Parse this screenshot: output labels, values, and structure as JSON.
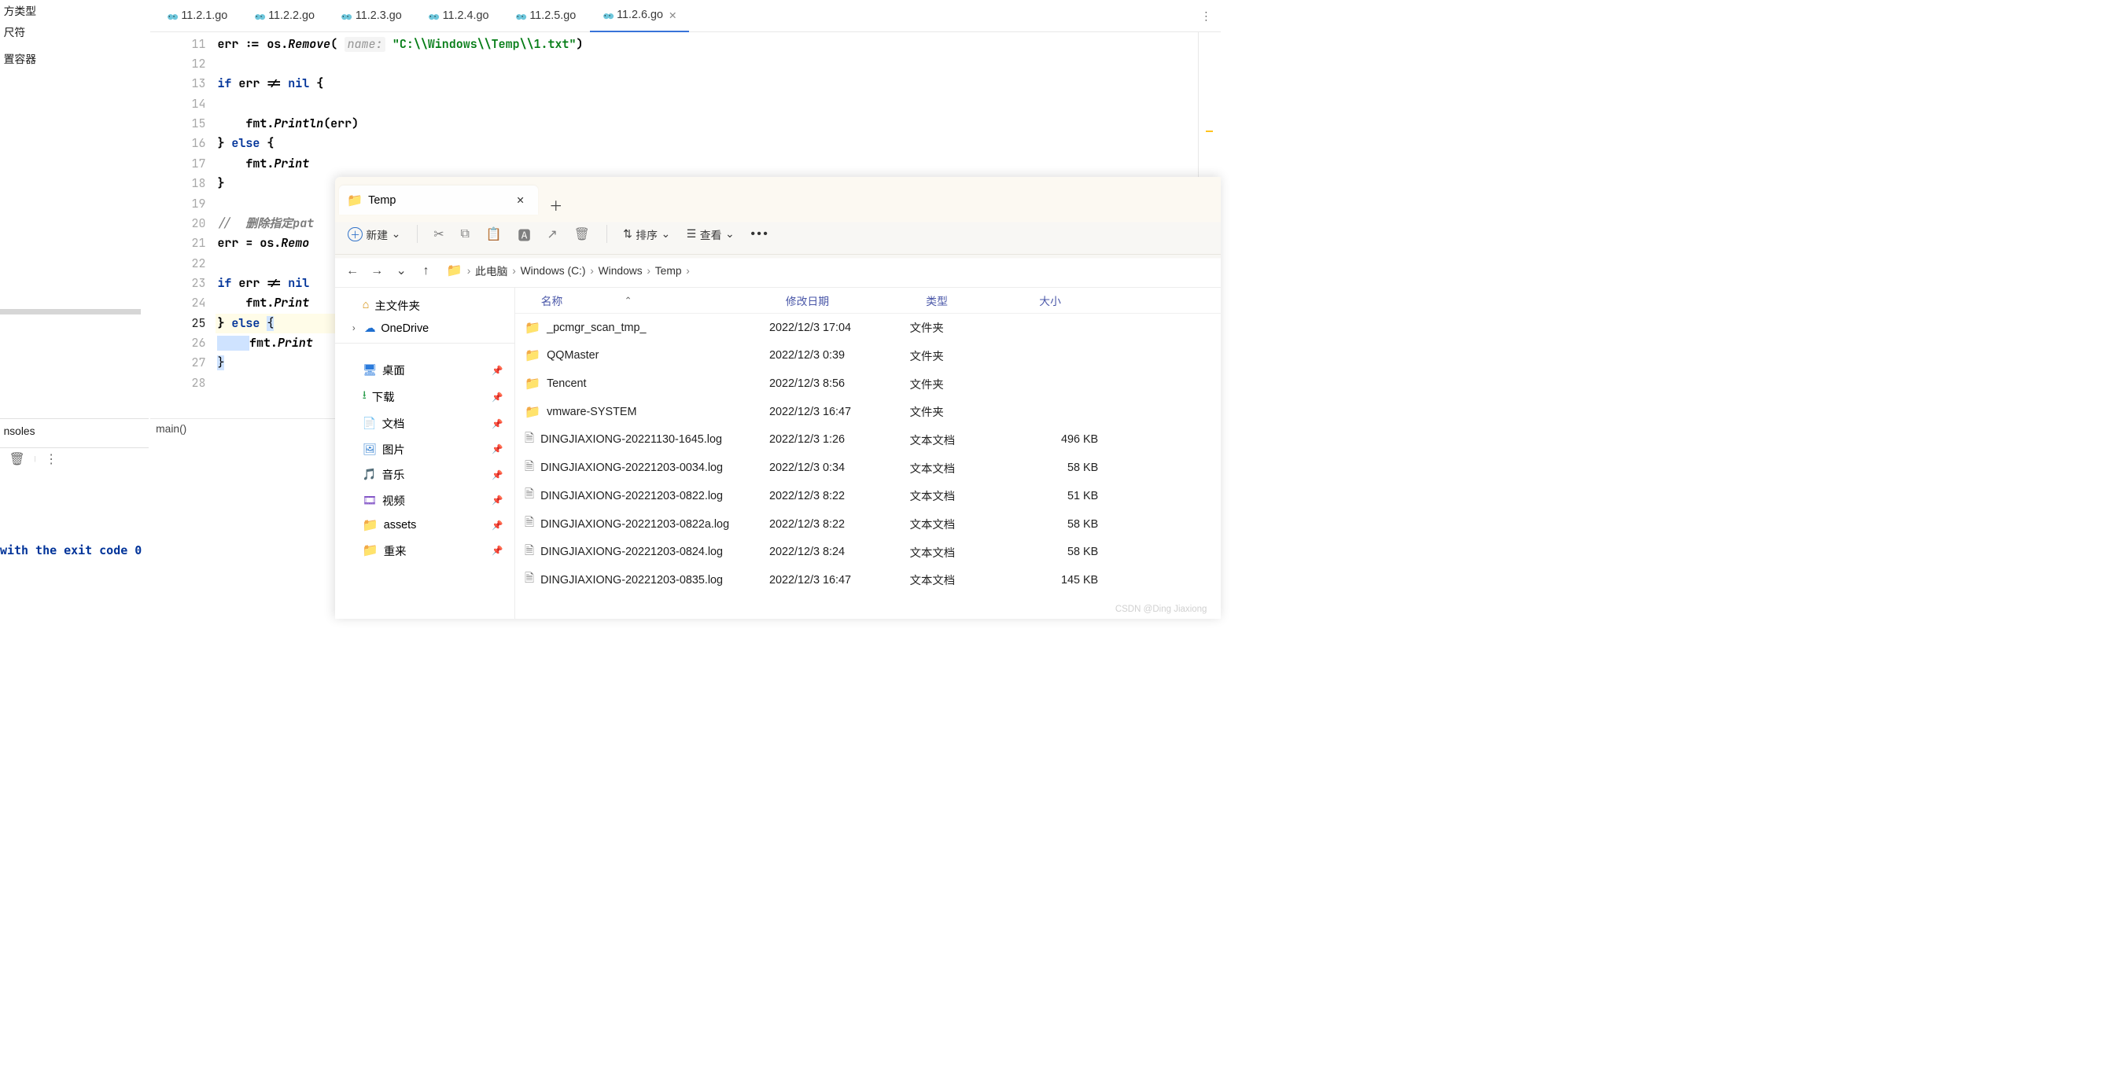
{
  "ide": {
    "left_panel": {
      "items": [
        {
          "label": "方类型"
        },
        {
          "label": "尺符"
        },
        {
          "label": ""
        },
        {
          "label": "置容器"
        }
      ],
      "selected_index": null,
      "footer_label": "nsoles"
    },
    "tabs": [
      {
        "label": "11.2.1.go"
      },
      {
        "label": "11.2.2.go"
      },
      {
        "label": "11.2.3.go"
      },
      {
        "label": "11.2.4.go"
      },
      {
        "label": "11.2.5.go"
      },
      {
        "label": "11.2.6.go",
        "active": true
      }
    ],
    "gutter_start": 11,
    "code_lines": [
      {
        "html": "<span class='bold'>err := os.</span><span class='bold fn-ital'>Remove</span><span class='bold'>(</span> <span class='hint'>name:</span> <span class='str'>\"C:\\\\Windows\\\\Temp\\\\1.txt\"</span><span class='bold'>)</span>"
      },
      {
        "html": ""
      },
      {
        "html": "<span class='k'>if</span><span class='bold'> err != </span><span class='k'>nil</span><span class='bold'> {</span>"
      },
      {
        "html": ""
      },
      {
        "html": "    <span class='bold'>fmt.</span><span class='bold fn-ital'>Println</span><span class='bold'>(err)</span>"
      },
      {
        "html": "<span class='bold'>} </span><span class='k'>else</span><span class='bold'> {</span>"
      },
      {
        "html": "    <span class='bold'>fmt.</span><span class='bold fn-ital'>Print</span>"
      },
      {
        "html": "<span class='bold'>}</span>"
      },
      {
        "html": ""
      },
      {
        "html": "<span class='cmt'>//  </span><span class='cmt-bold'>删除指定</span><span class='cmt-bold'>pat</span>"
      },
      {
        "html": "<span class='bold'>err = os.</span><span class='bold fn-ital'>Remo</span>"
      },
      {
        "html": ""
      },
      {
        "html": "<span class='k'>if</span><span class='bold'> err != </span><span class='k'>nil</span>"
      },
      {
        "html": "    <span class='bold'>fmt.</span><span class='bold fn-ital'>Print</span>"
      },
      {
        "html": "<span class='bold'>} </span><span class='k'>else</span><span class='bold'> </span><span class='sel'>{</span>",
        "current": true
      },
      {
        "html": "<span class='sel' style='padding-left:8px'>    </span><span class='bold'>fmt.</span><span class='bold fn-ital'>Print</span>"
      },
      {
        "html": "<span class='sel paren-hl'>}</span>"
      },
      {
        "html": ""
      }
    ],
    "breadcrumb": "main()",
    "run_output": "with the exit code 0"
  },
  "explorer": {
    "tab_title": "Temp",
    "toolbar": {
      "new_label": "新建",
      "sort_label": "排序",
      "view_label": "查看"
    },
    "breadcrumb": [
      "此电脑",
      "Windows (C:)",
      "Windows",
      "Temp"
    ],
    "sidebar": {
      "home_label": "主文件夹",
      "onedrive_label": "OneDrive",
      "quick_items": [
        {
          "icon": "desktop",
          "label": "桌面",
          "pinned": true
        },
        {
          "icon": "download",
          "label": "下载",
          "pinned": true
        },
        {
          "icon": "doc",
          "label": "文档",
          "pinned": true
        },
        {
          "icon": "picture",
          "label": "图片",
          "pinned": true
        },
        {
          "icon": "music",
          "label": "音乐",
          "pinned": true
        },
        {
          "icon": "video",
          "label": "视频",
          "pinned": true
        },
        {
          "icon": "folder",
          "label": "assets",
          "pinned": true
        },
        {
          "icon": "folder",
          "label": "重来",
          "pinned": true
        }
      ]
    },
    "headers": {
      "name": "名称",
      "date": "修改日期",
      "type": "类型",
      "size": "大小"
    },
    "files": [
      {
        "kind": "folder",
        "name": "_pcmgr_scan_tmp_",
        "date": "2022/12/3 17:04",
        "type": "文件夹",
        "size": ""
      },
      {
        "kind": "folder",
        "name": "QQMaster",
        "date": "2022/12/3 0:39",
        "type": "文件夹",
        "size": ""
      },
      {
        "kind": "folder",
        "name": "Tencent",
        "date": "2022/12/3 8:56",
        "type": "文件夹",
        "size": ""
      },
      {
        "kind": "folder",
        "name": "vmware-SYSTEM",
        "date": "2022/12/3 16:47",
        "type": "文件夹",
        "size": ""
      },
      {
        "kind": "file",
        "name": "DINGJIAXIONG-20221130-1645.log",
        "date": "2022/12/3 1:26",
        "type": "文本文档",
        "size": "496 KB"
      },
      {
        "kind": "file",
        "name": "DINGJIAXIONG-20221203-0034.log",
        "date": "2022/12/3 0:34",
        "type": "文本文档",
        "size": "58 KB"
      },
      {
        "kind": "file",
        "name": "DINGJIAXIONG-20221203-0822.log",
        "date": "2022/12/3 8:22",
        "type": "文本文档",
        "size": "51 KB"
      },
      {
        "kind": "file",
        "name": "DINGJIAXIONG-20221203-0822a.log",
        "date": "2022/12/3 8:22",
        "type": "文本文档",
        "size": "58 KB"
      },
      {
        "kind": "file",
        "name": "DINGJIAXIONG-20221203-0824.log",
        "date": "2022/12/3 8:24",
        "type": "文本文档",
        "size": "58 KB"
      },
      {
        "kind": "file",
        "name": "DINGJIAXIONG-20221203-0835.log",
        "date": "2022/12/3 16:47",
        "type": "文本文档",
        "size": "145 KB"
      }
    ]
  },
  "watermark": "CSDN @Ding Jiaxiong"
}
